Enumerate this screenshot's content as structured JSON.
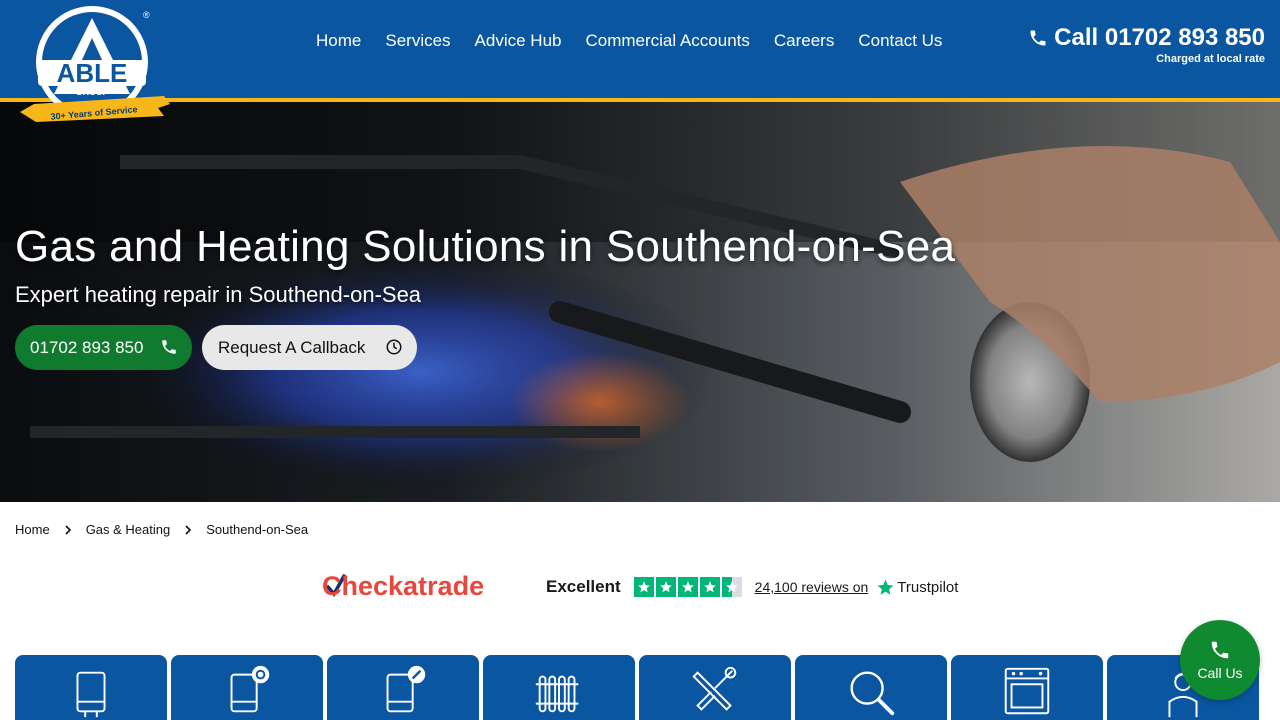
{
  "brand": {
    "logo_text": "ABLE",
    "logo_group": "GROUP",
    "logo_ribbon": "30+ Years of Service",
    "registered": "®",
    "primary_color": "#0a56a0",
    "accent_color": "#f7b718",
    "green": "#107a2e"
  },
  "nav": {
    "items": [
      {
        "label": "Home"
      },
      {
        "label": "Services"
      },
      {
        "label": "Advice Hub"
      },
      {
        "label": "Commercial Accounts"
      },
      {
        "label": "Careers"
      },
      {
        "label": "Contact Us"
      }
    ]
  },
  "header_call": {
    "label": "Call 01702 893 850",
    "sub": "Charged at local rate",
    "icon": "phone-icon"
  },
  "hero": {
    "title": "Gas and Heating Solutions in Southend-on-Sea",
    "subtitle": "Expert heating repair in Southend-on-Sea",
    "phone_button": "01702 893 850",
    "callback_button": "Request A Callback"
  },
  "breadcrumb": {
    "items": [
      {
        "label": "Home"
      },
      {
        "label": "Gas & Heating"
      },
      {
        "label": "Southend-on-Sea"
      }
    ]
  },
  "ratings": {
    "checkatrade": "Checkatrade",
    "trustpilot_rating": "Excellent",
    "stars": 4.5,
    "reviews": "24,100 reviews on",
    "trustpilot_name": "Trustpilot"
  },
  "services": {
    "icons": [
      "boiler-icon",
      "boiler-service-icon",
      "boiler-repair-icon",
      "radiator-icon",
      "tools-icon",
      "search-icon",
      "oven-icon",
      "engineer-icon"
    ]
  },
  "fab": {
    "label": "Call Us",
    "icon": "phone-icon"
  }
}
